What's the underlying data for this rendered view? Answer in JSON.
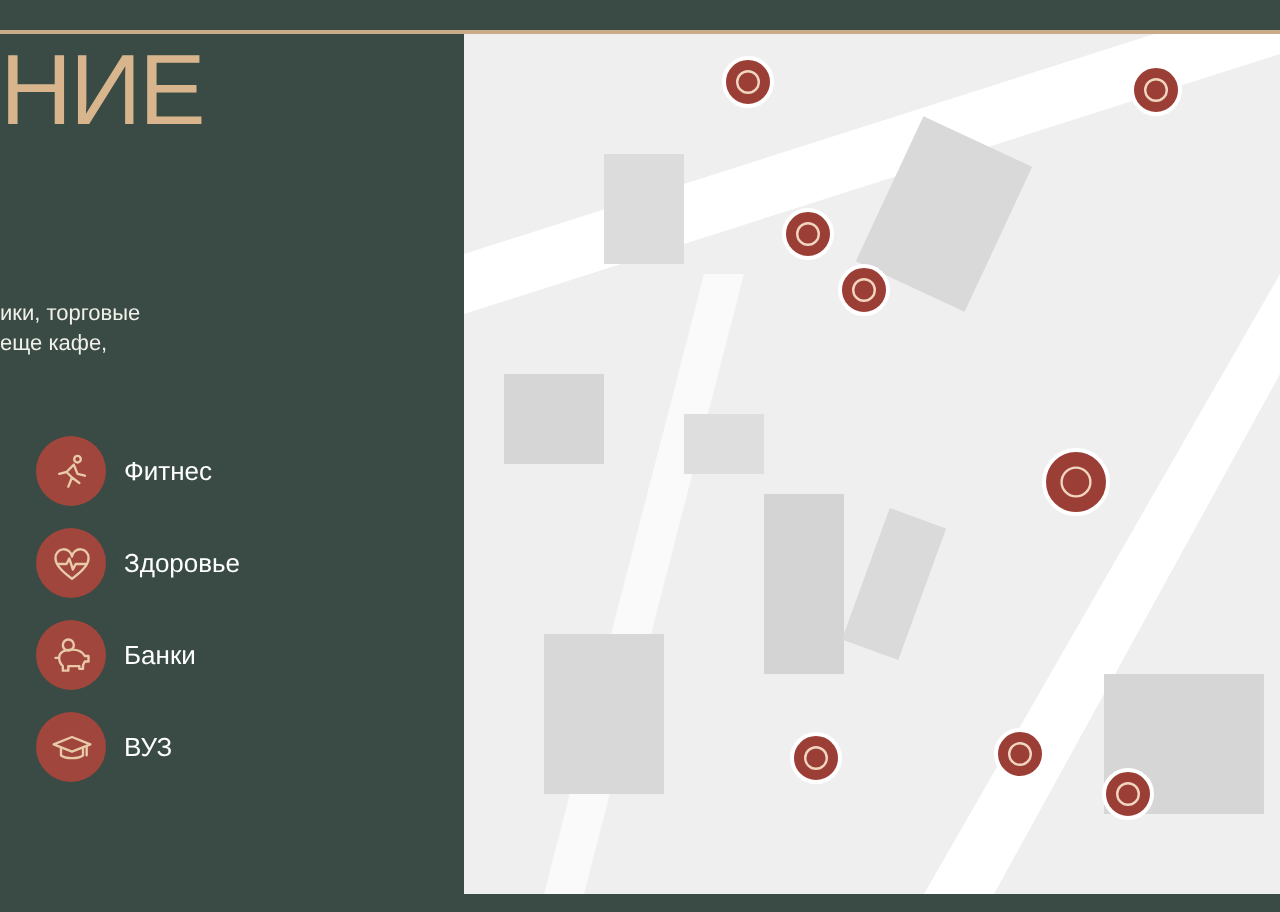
{
  "heading": "НИЕ",
  "description_lines": [
    "ики, торговые",
    "еще кафе,"
  ],
  "legend": [
    {
      "label": "Фитнес",
      "kind": "fitness"
    },
    {
      "label": "Здоровье",
      "kind": "health"
    },
    {
      "label": "Банки",
      "kind": "bank"
    },
    {
      "label": "ВУЗ",
      "kind": "university"
    }
  ]
}
